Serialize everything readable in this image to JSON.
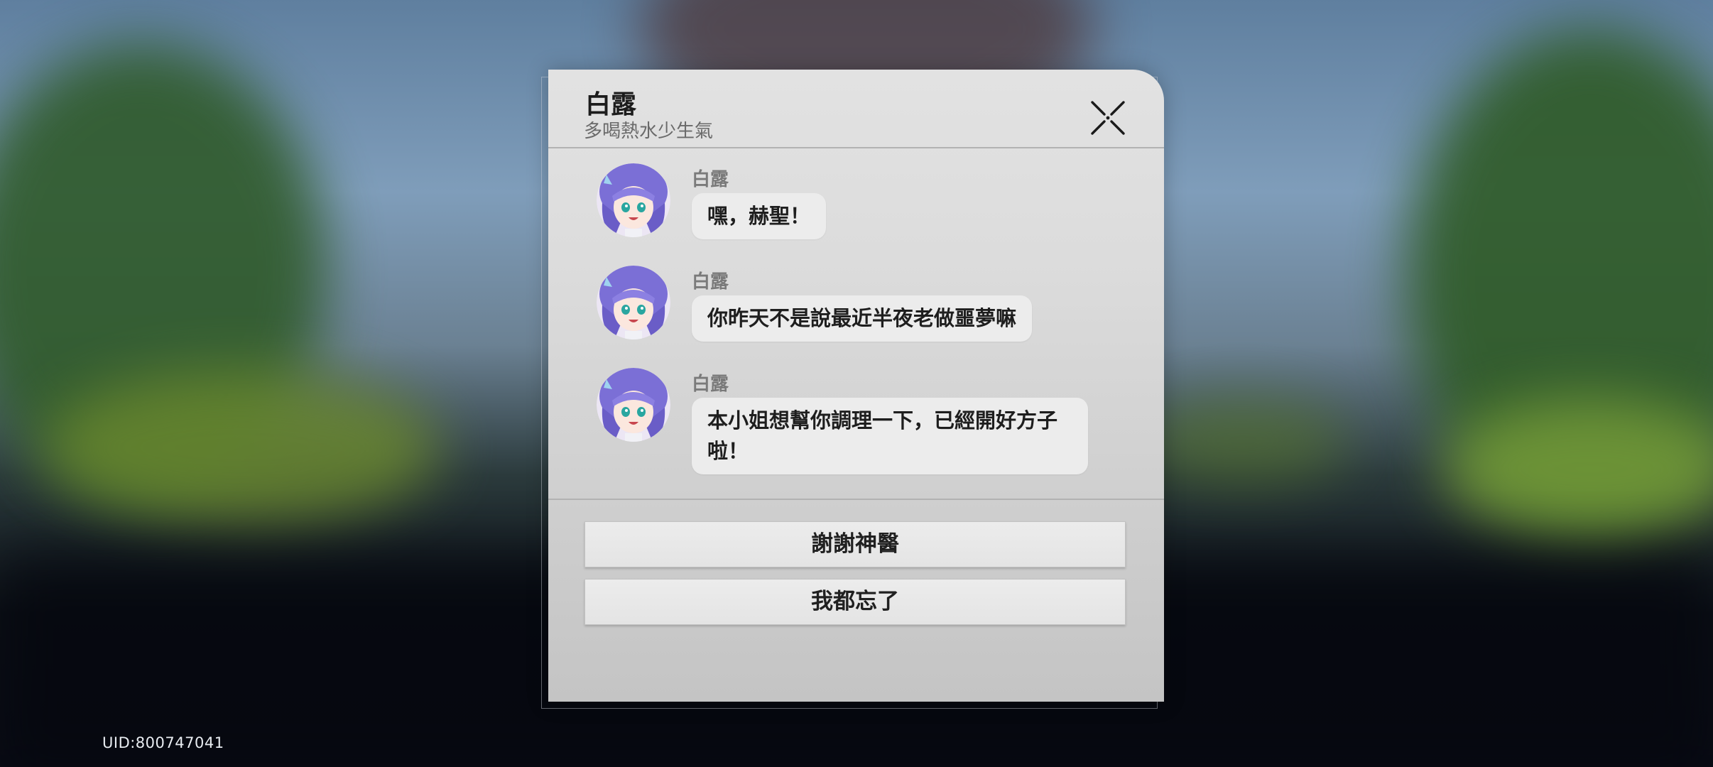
{
  "dialog": {
    "title": "白露",
    "subtitle": "多喝熱水少生氣"
  },
  "messages": [
    {
      "sender": "白露",
      "text": "嘿，赫聖！"
    },
    {
      "sender": "白露",
      "text": "你昨天不是說最近半夜老做噩夢嘛"
    },
    {
      "sender": "白露",
      "text": "本小姐想幫你調理一下，已經開好方子啦！"
    }
  ],
  "options": [
    {
      "label": "謝謝神醫"
    },
    {
      "label": "我都忘了"
    }
  ],
  "footer": {
    "uid": "UID:800747041"
  },
  "colors": {
    "panel": "#dcdcdc",
    "bubble": "#ececec",
    "avatar_hair": "#7b6fd6"
  },
  "icons": [
    "close-icon",
    "avatar-icon"
  ]
}
